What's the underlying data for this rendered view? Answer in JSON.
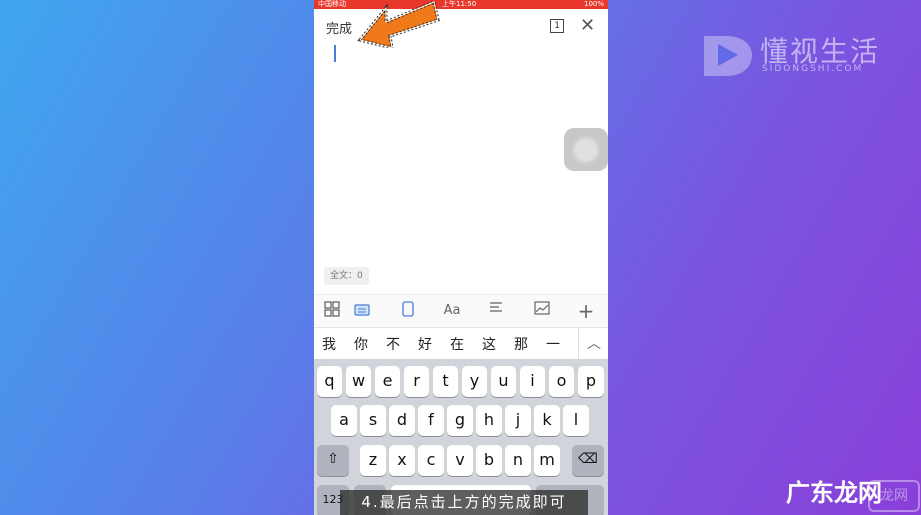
{
  "status_bar": {
    "carrier": "中国移动",
    "time": "上午11:50",
    "battery": "100%"
  },
  "editor": {
    "done_label": "完成",
    "page_count": "1",
    "word_count": "全文：0"
  },
  "toolbar": {
    "icons": [
      "grid-icon",
      "keyboard-icon",
      "phone-layout-icon",
      "font-icon",
      "align-icon",
      "image-icon",
      "add-icon"
    ]
  },
  "candidates": [
    "我",
    "你",
    "不",
    "好",
    "在",
    "这",
    "那",
    "一"
  ],
  "keyboard": {
    "row1": [
      "q",
      "w",
      "e",
      "r",
      "t",
      "y",
      "u",
      "i",
      "o",
      "p"
    ],
    "row2": [
      "a",
      "s",
      "d",
      "f",
      "g",
      "h",
      "j",
      "k",
      "l"
    ],
    "row3": [
      "z",
      "x",
      "c",
      "v",
      "b",
      "n",
      "m"
    ],
    "num_key": "123"
  },
  "subtitle": "4.最后点击上方的完成即可",
  "brand": {
    "name": "懂视生活",
    "domain": "SIDONGSHI.COM"
  },
  "watermark": {
    "text": "广东龙网",
    "badge": "龙网"
  },
  "colors": {
    "status_bar": "#e8382c",
    "arrow": "#f07a1a",
    "accent": "#4a7bd6"
  }
}
